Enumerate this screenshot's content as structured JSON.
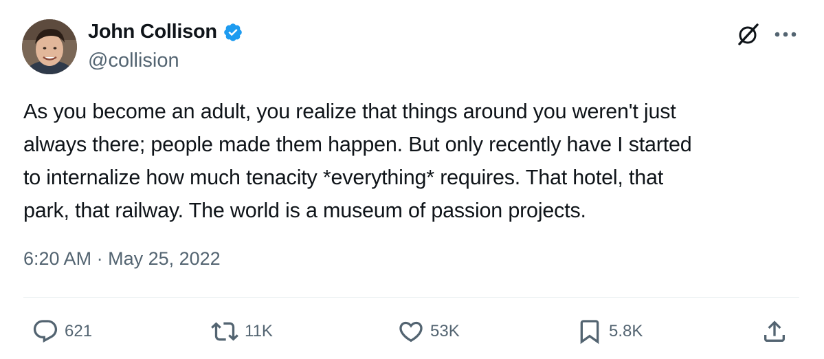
{
  "author": {
    "display_name": "John Collison",
    "handle": "@collision",
    "verified": true
  },
  "tweet": {
    "text": "As you become an adult, you realize that things around you weren't just\nalways there; people made them happen. But only recently have I started\nto internalize how much tenacity *everything* requires. That hotel, that\npark, that railway. The world is a museum of passion projects.",
    "time": "6:20 AM",
    "separator": "·",
    "date": "May 25, 2022"
  },
  "actions": {
    "replies": "621",
    "reposts": "11K",
    "likes": "53K",
    "bookmarks": "5.8K"
  },
  "icons": {
    "verified": "verified-badge-icon",
    "grok": "grok-icon",
    "more": "more-icon",
    "reply": "reply-icon",
    "repost": "repost-icon",
    "like": "like-icon",
    "bookmark": "bookmark-icon",
    "share": "share-icon"
  },
  "colors": {
    "text": "#0f1419",
    "secondary": "#536471",
    "verified": "#1d9bf0",
    "divider": "#eff3f4"
  }
}
